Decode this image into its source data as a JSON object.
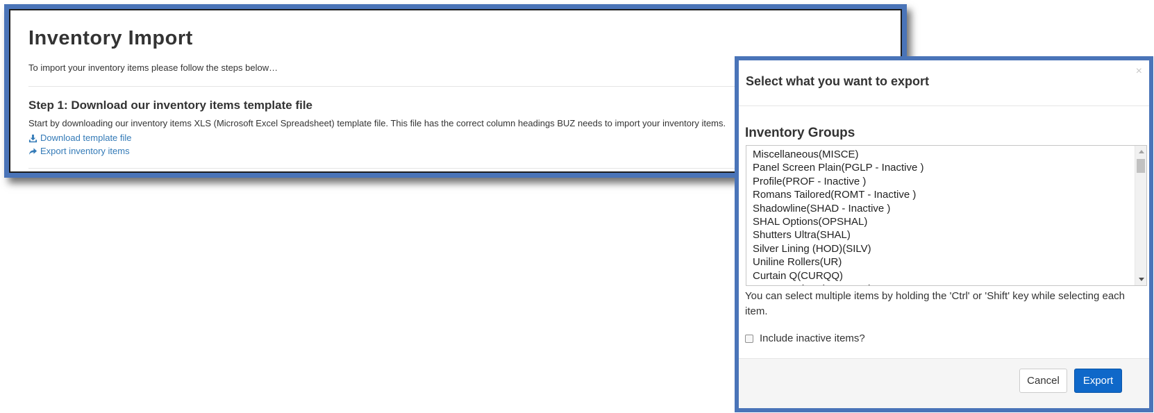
{
  "page": {
    "title": "Inventory Import",
    "intro": "To import your inventory items please follow the steps below…",
    "step1": {
      "title": "Step 1: Download our inventory items template file",
      "description": "Start by downloading our inventory items XLS (Microsoft Excel Spreadsheet) template file. This file has the correct column headings BUZ needs to import your inventory items.",
      "download_link": "Download template file",
      "export_link": "Export inventory items"
    }
  },
  "modal": {
    "title": "Select what you want to export",
    "close_label": "×",
    "groups_heading": "Inventory Groups",
    "groups": [
      "Miscellaneous(MISCE)",
      "Panel Screen Plain(PGLP - Inactive )",
      "Profile(PROF - Inactive )",
      "Romans Tailored(ROMT - Inactive )",
      "Shadowline(SHAD - Inactive )",
      "SHAL Options(OPSHAL)",
      "Shutters Ultra(SHAL)",
      "Silver Lining (HOD)(SILV)",
      "Uniline Rollers(UR)",
      "Curtain Q(CURQQ)",
      "JBM Curtain Q(JCURQQ)"
    ],
    "help_text": "You can select multiple items by holding the 'Ctrl' or 'Shift' key while selecting each item.",
    "include_inactive_label": "Include inactive items?",
    "include_inactive_checked": false,
    "cancel_label": "Cancel",
    "export_label": "Export"
  },
  "colors": {
    "frame_border": "#4a74b8",
    "link": "#337ab7",
    "primary_button": "#0f68c9"
  },
  "icons": {
    "download": "download-icon",
    "export": "share-arrow-icon",
    "close": "close-icon",
    "scroll_up": "scroll-up-arrow-icon",
    "scroll_down": "scroll-down-arrow-icon"
  }
}
